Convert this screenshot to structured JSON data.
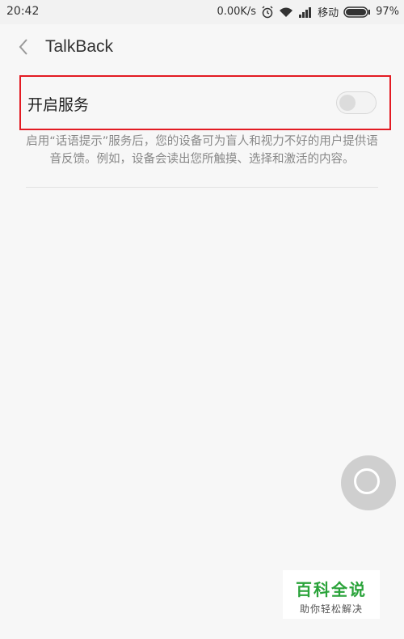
{
  "status_bar": {
    "time": "20:42",
    "network_speed": "0.00K/s",
    "carrier": "移动",
    "battery": "97%",
    "icons": [
      "alarm-icon",
      "wifi-icon",
      "signal-icon",
      "battery-icon"
    ]
  },
  "header": {
    "title": "TalkBack",
    "back_icon": "chevron-left-icon"
  },
  "service": {
    "label": "开启服务",
    "enabled": false,
    "description": "启用“话语提示”服务后，您的设备可为盲人和视力不好的用户提供语音反馈。例如，设备会读出您所触摸、选择和激活的内容。"
  },
  "watermark": {
    "title": "百科全说",
    "subtitle": "助你轻松解决"
  },
  "colors": {
    "highlight_border": "#e31b23",
    "watermark_green": "#2aa33a"
  }
}
